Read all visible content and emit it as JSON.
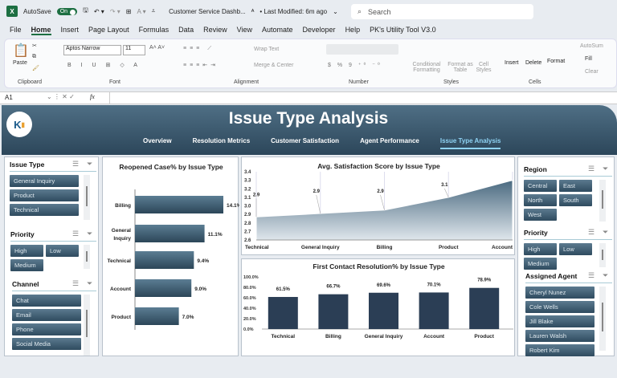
{
  "titlebar": {
    "app_icon": "X",
    "autosave_label": "AutoSave",
    "autosave_state": "On",
    "doc_title": "Customer Service Dashb...",
    "last_modified": "• Last Modified: 6m ago",
    "search_placeholder": "Search"
  },
  "menu": [
    "File",
    "Home",
    "Insert",
    "Page Layout",
    "Formulas",
    "Data",
    "Review",
    "View",
    "Automate",
    "Developer",
    "Help",
    "PK's Utility Tool V3.0"
  ],
  "ribbon": {
    "paste": "Paste",
    "font_name": "Aptos Narrow",
    "font_size": "11",
    "wrap_text": "Wrap Text",
    "merge_center": "Merge & Center",
    "conditional_formatting": "Conditional Formatting",
    "format_as_table": "Format as Table",
    "cell_styles": "Cell Styles",
    "insert": "Insert",
    "delete": "Delete",
    "format": "Format",
    "autosum": "AutoSum",
    "fill": "Fill",
    "clear": "Clear",
    "groups": [
      "Clipboard",
      "Font",
      "Alignment",
      "Number",
      "Styles",
      "Cells"
    ]
  },
  "formula_bar": {
    "cell_ref": "A1",
    "fx": "fx",
    "value": ""
  },
  "dashboard": {
    "logo_text": "PK",
    "title": "Issue Type Analysis",
    "tabs": [
      "Overview",
      "Resolution Metrics",
      "Customer Satisfaction",
      "Agent Performance",
      "Issue Type Analysis"
    ],
    "active_tab": "Issue Type Analysis"
  },
  "slicers_left": [
    {
      "title": "Issue Type",
      "items": [
        "General Inquiry",
        "Product",
        "Technical"
      ]
    },
    {
      "title": "Priority",
      "items": [
        "High",
        "Low",
        "Medium"
      ]
    },
    {
      "title": "Channel",
      "items": [
        "Chat",
        "Email",
        "Phone",
        "Social Media"
      ]
    }
  ],
  "slicers_right": [
    {
      "title": "Region",
      "items": [
        "Central",
        "East",
        "North",
        "South",
        "West"
      ]
    },
    {
      "title": "Priority",
      "items": [
        "High",
        "Low",
        "Medium"
      ]
    },
    {
      "title": "Assigned Agent",
      "items": [
        "Cheryl Nunez",
        "Cole Wells",
        "Jill Blake",
        "Lauren Walsh",
        "Robert Kim"
      ]
    }
  ],
  "chart_data": [
    {
      "type": "bar",
      "orientation": "horizontal",
      "title": "Reopened Case% by Issue Type",
      "categories": [
        "Billing",
        "General Inquiry",
        "Technical",
        "Account",
        "Product"
      ],
      "values": [
        14.1,
        11.1,
        9.4,
        9.0,
        7.0
      ],
      "labels": [
        "14.1%",
        "11.1%",
        "9.4%",
        "9.0%",
        "7.0%"
      ],
      "color": "#3d5c71"
    },
    {
      "type": "area",
      "title": "Avg. Satisfaction Score by Issue Type",
      "categories": [
        "Technical",
        "General Inquiry",
        "Billing",
        "Product",
        "Account"
      ],
      "values": [
        2.87,
        2.91,
        2.95,
        3.1,
        3.3
      ],
      "labels": [
        "2.9",
        "2.9",
        "2.9",
        "3.1",
        "3.3"
      ],
      "ylim": [
        2.6,
        3.4
      ],
      "yticks": [
        "2.6",
        "2.7",
        "2.8",
        "2.9",
        "3.0",
        "3.1",
        "3.2",
        "3.3",
        "3.4"
      ],
      "grid": "vertical",
      "color": "#4e6e84"
    },
    {
      "type": "bar",
      "title": "First Contact Resolution% by Issue Type",
      "categories": [
        "Technical",
        "Billing",
        "General Inquiry",
        "Account",
        "Product"
      ],
      "values": [
        61.5,
        66.7,
        69.6,
        70.1,
        78.9
      ],
      "labels": [
        "61.5%",
        "66.7%",
        "69.6%",
        "70.1%",
        "78.9%"
      ],
      "ylim": [
        0,
        100
      ],
      "yticks": [
        "0.0%",
        "20.0%",
        "40.0%",
        "60.0%",
        "80.0%",
        "100.0%"
      ],
      "color": "#2b3e55"
    }
  ]
}
